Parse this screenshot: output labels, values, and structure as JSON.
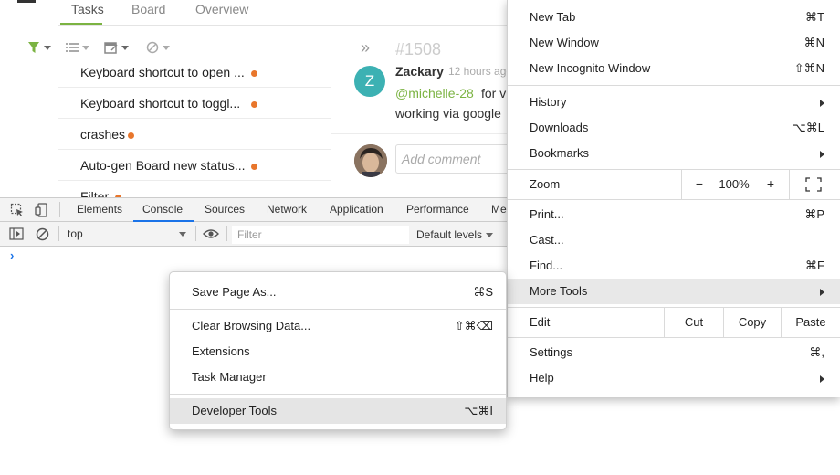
{
  "app": {
    "tabs": [
      {
        "label": "Tasks",
        "active": true
      },
      {
        "label": "Board",
        "active": false
      },
      {
        "label": "Overview",
        "active": false
      }
    ],
    "accent_color": "#7bb342",
    "filter_icons": [
      "filter-icon",
      "list-icon",
      "calendar-icon",
      "blocked-icon"
    ],
    "tasks": [
      {
        "title": "Keyboard shortcut to open ..."
      },
      {
        "title": "Keyboard shortcut to toggl..."
      },
      {
        "title": "crashes"
      },
      {
        "title": "Auto-gen Board new status..."
      },
      {
        "title": "Filter"
      }
    ],
    "status_dot_color": "#e8762c",
    "detail": {
      "issue_id": "#1508",
      "avatar_letter": "Z",
      "author": "Zackary",
      "time": "12 hours ago",
      "mention": "@michelle-28",
      "message_line1": "for v",
      "message_line2": "working via google",
      "comment_placeholder": "Add comment"
    }
  },
  "devtools": {
    "tabs": [
      {
        "label": "Elements",
        "active": false
      },
      {
        "label": "Console",
        "active": true
      },
      {
        "label": "Sources",
        "active": false
      },
      {
        "label": "Network",
        "active": false
      },
      {
        "label": "Application",
        "active": false
      },
      {
        "label": "Performance",
        "active": false
      },
      {
        "label": "Me",
        "active": false
      }
    ],
    "context": "top",
    "filter_placeholder": "Filter",
    "levels": "Default levels",
    "prompt": "›"
  },
  "chrome_menu": {
    "new_tab": {
      "label": "New Tab",
      "shortcut": "⌘T"
    },
    "new_window": {
      "label": "New Window",
      "shortcut": "⌘N"
    },
    "new_incognito": {
      "label": "New Incognito Window",
      "shortcut": "⇧⌘N"
    },
    "history": {
      "label": "History"
    },
    "downloads": {
      "label": "Downloads",
      "shortcut": "⌥⌘L"
    },
    "bookmarks": {
      "label": "Bookmarks"
    },
    "zoom": {
      "label": "Zoom",
      "minus": "−",
      "value": "100%",
      "plus": "+"
    },
    "print": {
      "label": "Print...",
      "shortcut": "⌘P"
    },
    "cast": {
      "label": "Cast..."
    },
    "find": {
      "label": "Find...",
      "shortcut": "⌘F"
    },
    "more_tools": {
      "label": "More Tools",
      "highlighted": true
    },
    "edit": {
      "label": "Edit",
      "cut": "Cut",
      "copy": "Copy",
      "paste": "Paste"
    },
    "settings": {
      "label": "Settings",
      "shortcut": "⌘,"
    },
    "help": {
      "label": "Help"
    }
  },
  "more_tools_menu": {
    "save_page": {
      "label": "Save Page As...",
      "shortcut": "⌘S"
    },
    "clear_data": {
      "label": "Clear Browsing Data...",
      "shortcut": "⇧⌘⌫"
    },
    "extensions": {
      "label": "Extensions"
    },
    "task_manager": {
      "label": "Task Manager"
    },
    "developer_tools": {
      "label": "Developer Tools",
      "shortcut": "⌥⌘I",
      "highlighted": true
    }
  }
}
